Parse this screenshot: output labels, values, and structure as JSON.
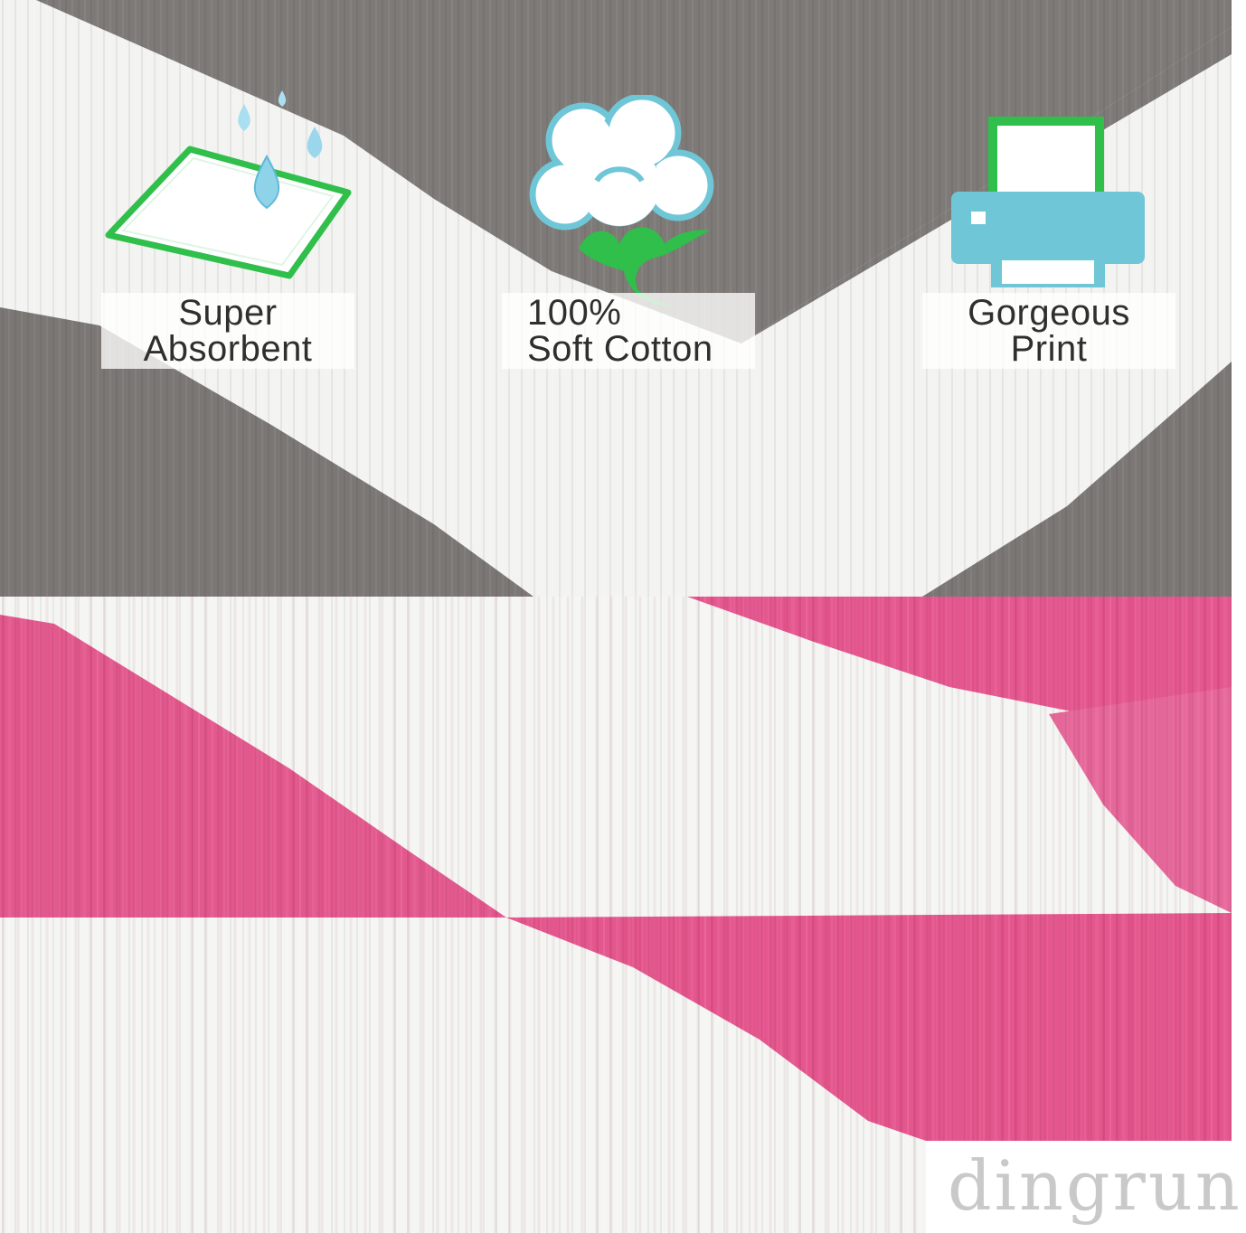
{
  "colors": {
    "grey_stripe": "#7d7976",
    "white_fabric": "#f4f4f2",
    "pink_stripe": "#e4578e",
    "icon_green": "#2fbf4a",
    "icon_teal": "#6ec6d6"
  },
  "features": [
    {
      "icon": "water-drop-pad-icon",
      "line1": "Super",
      "line2": "Absorbent"
    },
    {
      "icon": "cotton-boll-icon",
      "line1": "100%",
      "line2": "Soft Cotton"
    },
    {
      "icon": "printer-icon",
      "line1": "Gorgeous",
      "line2": "Print"
    }
  ],
  "watermark": {
    "text": "dingrun"
  }
}
